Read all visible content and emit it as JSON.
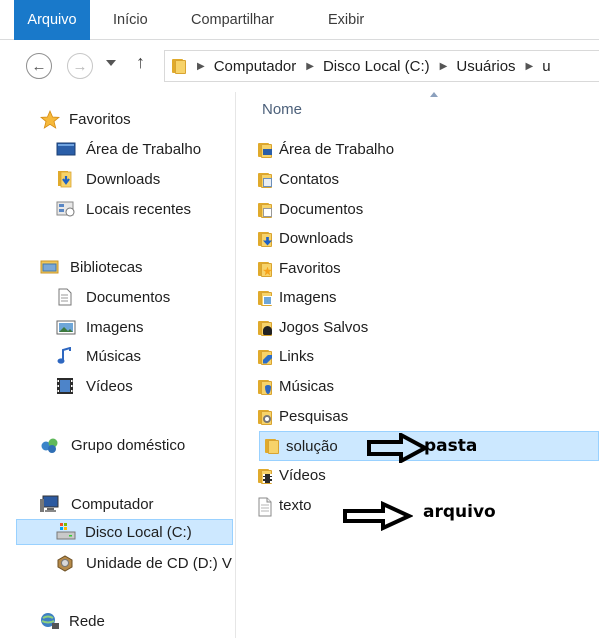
{
  "ribbon": {
    "tabs": [
      {
        "label": "Arquivo"
      },
      {
        "label": "Início"
      },
      {
        "label": "Compartilhar"
      },
      {
        "label": "Exibir"
      }
    ]
  },
  "address": {
    "crumbs": [
      "Computador",
      "Disco Local (C:)",
      "Usuários",
      "u"
    ]
  },
  "nav": {
    "favorites_header": "Favoritos",
    "favorites": [
      "Área de Trabalho",
      "Downloads",
      "Locais recentes"
    ],
    "libraries_header": "Bibliotecas",
    "libraries": [
      "Documentos",
      "Imagens",
      "Músicas",
      "Vídeos"
    ],
    "homegroup": "Grupo doméstico",
    "computer_header": "Computador",
    "computer": [
      "Disco Local (C:)",
      "Unidade de CD (D:) V"
    ],
    "network": "Rede"
  },
  "content": {
    "column_header": "Nome",
    "items": [
      {
        "name": "Área de Trabalho",
        "icon": "desktop-folder-icon"
      },
      {
        "name": "Contatos",
        "icon": "contacts-folder-icon"
      },
      {
        "name": "Documentos",
        "icon": "documents-folder-icon"
      },
      {
        "name": "Downloads",
        "icon": "downloads-folder-icon"
      },
      {
        "name": "Favoritos",
        "icon": "favorites-folder-icon"
      },
      {
        "name": "Imagens",
        "icon": "pictures-folder-icon"
      },
      {
        "name": "Jogos Salvos",
        "icon": "saved-games-folder-icon"
      },
      {
        "name": "Links",
        "icon": "links-folder-icon"
      },
      {
        "name": "Músicas",
        "icon": "music-folder-icon"
      },
      {
        "name": "Pesquisas",
        "icon": "searches-folder-icon"
      },
      {
        "name": "solução",
        "icon": "folder-icon",
        "selected": true
      },
      {
        "name": "Vídeos",
        "icon": "videos-folder-icon"
      },
      {
        "name": "texto",
        "icon": "text-file-icon"
      }
    ]
  },
  "annotations": {
    "folder_label": "pasta",
    "file_label": "arquivo"
  },
  "colors": {
    "accent": "#1979ca",
    "selection": "#cce8ff",
    "selection_border": "#99d1ff",
    "folder": "#f7d36a"
  }
}
